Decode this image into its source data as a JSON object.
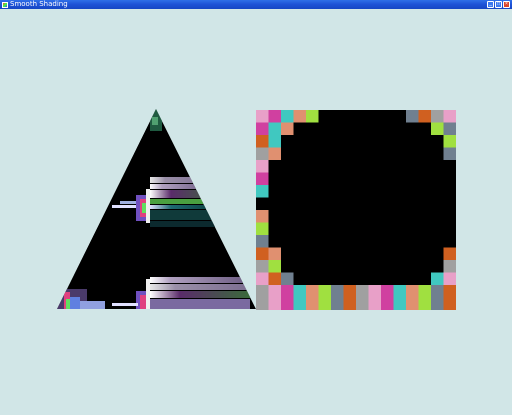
{
  "window": {
    "title": "Smooth Shading",
    "buttons": {
      "minimize": "minimize-icon",
      "maximize": "maximize-icon",
      "close": "close-icon"
    }
  },
  "scene": {
    "background_color": "#d1e6e7",
    "fill_color": "#000000",
    "shapes": [
      "triangle",
      "square"
    ],
    "border_palette": [
      "#e8a0c8",
      "#b47a5a",
      "#a0908c",
      "#8c9a2a",
      "#a06850",
      "#48b870",
      "#f0f040",
      "#d040a0",
      "#d8b0e8",
      "#7a2020",
      "#8a90d0",
      "#a09010",
      "#e03030",
      "#6040a0",
      "#40c8c0",
      "#d0e020",
      "#b06010",
      "#f0f060",
      "#2020c0",
      "#70e060",
      "#e070a0",
      "#e09070",
      "#7080a0",
      "#20c0a0",
      "#a070c0",
      "#50e0e0",
      "#60b040",
      "#c06050",
      "#a0e040",
      "#506070",
      "#b0b0e0",
      "#70b0c0",
      "#c0c0c0",
      "#c06010",
      "#e060d0",
      "#708090",
      "#202020",
      "#e0a0e0",
      "#40a0a0",
      "#e04040",
      "#90d090",
      "#6050c0",
      "#d06020",
      "#a01060",
      "#40b090",
      "#30a030",
      "#80f080",
      "#106040",
      "#206080",
      "#a0a0a0",
      "#708090",
      "#a020e0",
      "#e0e0e0",
      "#40c040",
      "#d0a0d0",
      "#5060b0"
    ]
  }
}
